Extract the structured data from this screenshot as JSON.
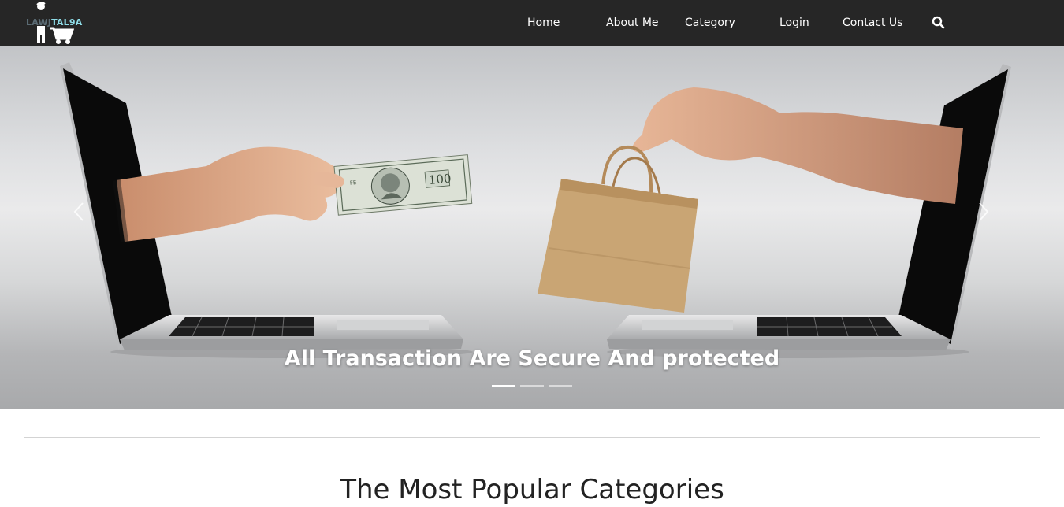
{
  "brand": {
    "logo_text_part1": "LAWJ",
    "logo_text_part2": "TAL9A"
  },
  "nav": {
    "home": "Home",
    "about": "About Me",
    "category": "Category",
    "login": "Login",
    "contact": "Contact Us",
    "search_icon": "search-icon"
  },
  "carousel": {
    "caption": "All Transaction Are Secure And protected",
    "slide_count": 3,
    "active_slide": 1,
    "prev_icon": "chevron-left-icon",
    "next_icon": "chevron-right-icon"
  },
  "content": {
    "section_title": "The Most Popular Categories"
  },
  "colors": {
    "navbar_bg": "#262626",
    "logo_accent": "#8fdde8"
  }
}
